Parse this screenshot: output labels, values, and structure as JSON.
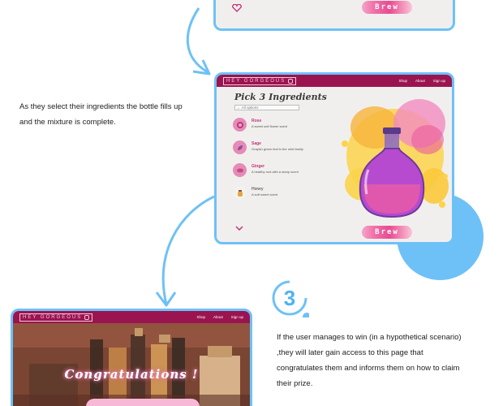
{
  "site": {
    "logo_text": "HEY GORGEOUS",
    "nav_links": [
      "Shop",
      "About",
      "Sign up"
    ]
  },
  "top_frame": {
    "brew_label": "Brew"
  },
  "middle_frame": {
    "title": "Pick 3 Ingredients",
    "dropdown": "All options",
    "ingredients": [
      {
        "name": "Rose",
        "description": "A sweet soft flower scent",
        "icon": "rose-icon"
      },
      {
        "name": "Sage",
        "description": "Grayish green leaf in the mint family",
        "icon": "sage-icon"
      },
      {
        "name": "Ginger",
        "description": "A healthy root with a sharp scent",
        "icon": "ginger-icon"
      },
      {
        "name": "Honey",
        "description": "A soft sweet scent",
        "icon": "honey-icon"
      }
    ],
    "brew_label": "Brew"
  },
  "captions": {
    "ingredients_caption": "As they select their ingredients the bottle fills up and the mixture is complete.",
    "prize_caption": "If the user manages to win (in a hypothetical scenario) ,they will later gain access to this page that congratulates them and informs them on how to claim their prize."
  },
  "step": {
    "number": "3"
  },
  "bottom_frame": {
    "hero_title": "Congratulations !"
  },
  "colors": {
    "accent_blue": "#6ec1f7",
    "nav_bar": "#9a1450",
    "pink": "#e84b90"
  }
}
